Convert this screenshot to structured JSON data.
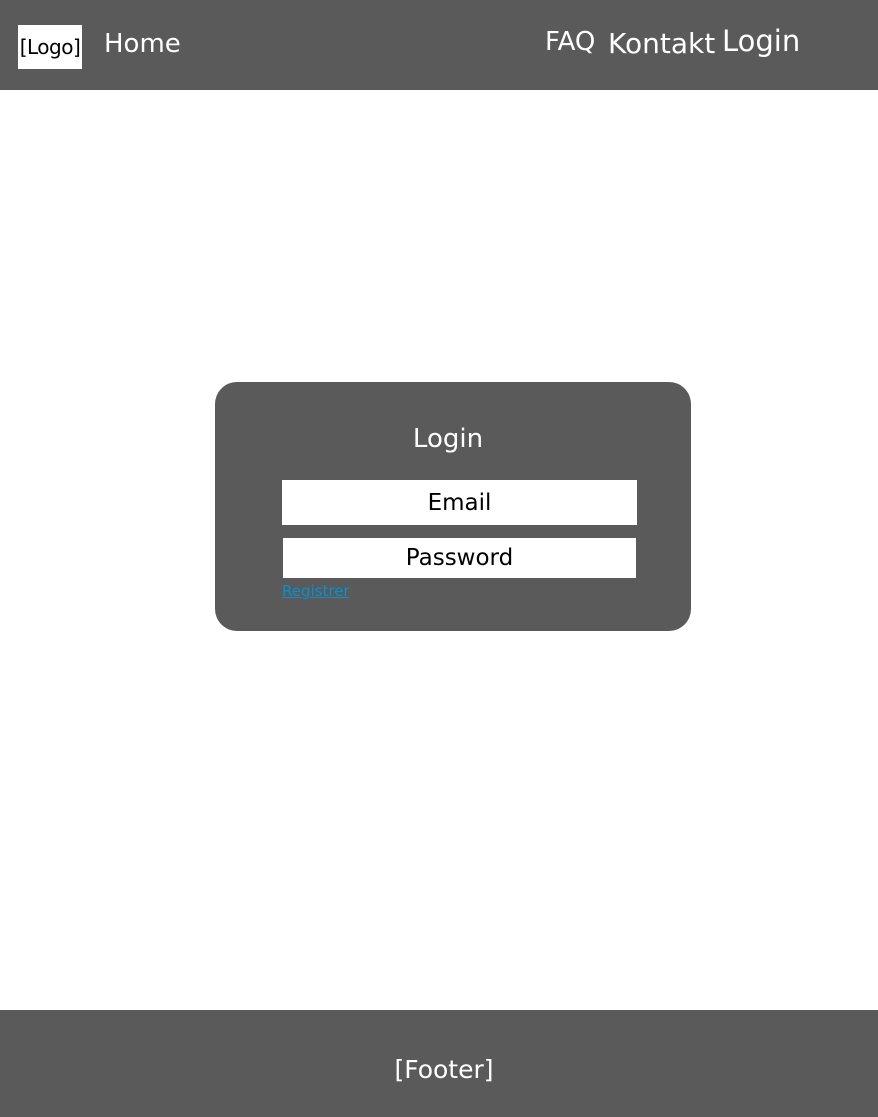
{
  "header": {
    "logo": "[Logo]",
    "nav": {
      "home": "Home",
      "faq": "FAQ",
      "kontakt": "Kontakt",
      "login": "Login"
    }
  },
  "login_card": {
    "title": "Login",
    "email_placeholder": "Email",
    "password_placeholder": "Password",
    "register_link": "Registrer"
  },
  "footer": {
    "text": "[Footer]"
  },
  "colors": {
    "header_bg": "#5a5a5a",
    "card_bg": "#5a5a5a",
    "footer_bg": "#5a5a5a",
    "link": "#0a8fd0"
  }
}
